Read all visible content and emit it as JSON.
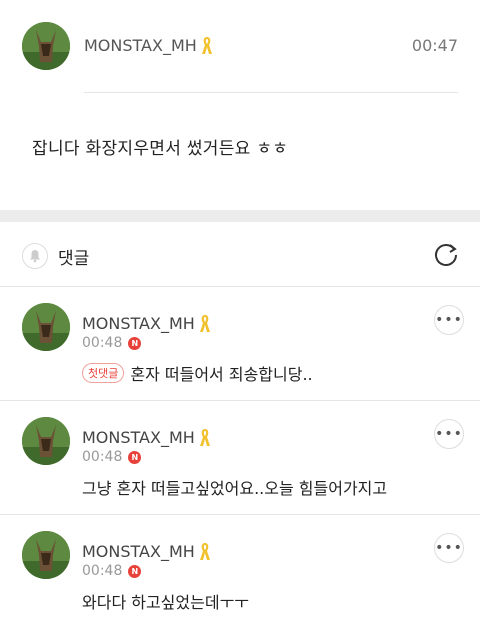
{
  "post": {
    "author": "MONSTAX_MH",
    "time": "00:47",
    "body": "잡니다 화장지우면서 썼거든요 ㅎㅎ"
  },
  "comments_header": {
    "title": "댓글",
    "icons": {
      "bell": "bell-icon",
      "refresh": "refresh-icon"
    }
  },
  "comments": [
    {
      "author": "MONSTAX_MH",
      "time": "00:48",
      "new_badge": "N",
      "first_label": "첫댓글",
      "text": "혼자 떠들어서 죄송합니당.."
    },
    {
      "author": "MONSTAX_MH",
      "time": "00:48",
      "new_badge": "N",
      "text": "그냥 혼자 떠들고싶었어요..오늘 힘들어가지고"
    },
    {
      "author": "MONSTAX_MH",
      "time": "00:48",
      "new_badge": "N",
      "text": "와다다 하고싶었는데ㅜㅜ"
    }
  ],
  "colors": {
    "accent_red": "#e8413a",
    "ribbon_yellow": "#f2c12e",
    "divider": "#e6e6e6"
  }
}
